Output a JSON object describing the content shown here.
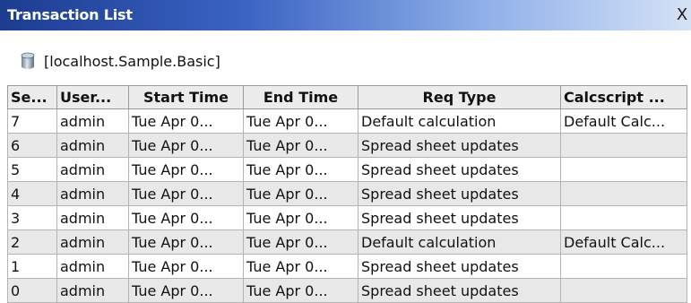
{
  "window": {
    "title": "Transaction List",
    "close_label": "X"
  },
  "location": {
    "text": "[localhost.Sample.Basic]",
    "icon": "database-icon"
  },
  "table": {
    "headers": [
      "Se...",
      "User...",
      "Start Time",
      "End Time",
      "Req Type",
      "Calcscript ..."
    ],
    "rows": [
      [
        "7",
        "admin",
        "Tue Apr 0...",
        "Tue Apr 0...",
        "Default calculation",
        "Default Calc..."
      ],
      [
        "6",
        "admin",
        "Tue Apr 0...",
        "Tue Apr 0...",
        "Spread sheet updates",
        ""
      ],
      [
        "5",
        "admin",
        "Tue Apr 0...",
        "Tue Apr 0...",
        "Spread sheet updates",
        ""
      ],
      [
        "4",
        "admin",
        "Tue Apr 0...",
        "Tue Apr 0...",
        "Spread sheet updates",
        ""
      ],
      [
        "3",
        "admin",
        "Tue Apr 0...",
        "Tue Apr 0...",
        "Spread sheet updates",
        ""
      ],
      [
        "2",
        "admin",
        "Tue Apr 0...",
        "Tue Apr 0...",
        "Default calculation",
        "Default Calc..."
      ],
      [
        "1",
        "admin",
        "Tue Apr 0...",
        "Tue Apr 0...",
        "Spread sheet updates",
        ""
      ],
      [
        "0",
        "admin",
        "Tue Apr 0...",
        "Tue Apr 0...",
        "Spread sheet updates",
        ""
      ]
    ]
  },
  "colors": {
    "titlebar_dark": "#1c3c8f",
    "titlebar_light": "#d4e2f6",
    "alt_row": "#e8e8e8"
  }
}
